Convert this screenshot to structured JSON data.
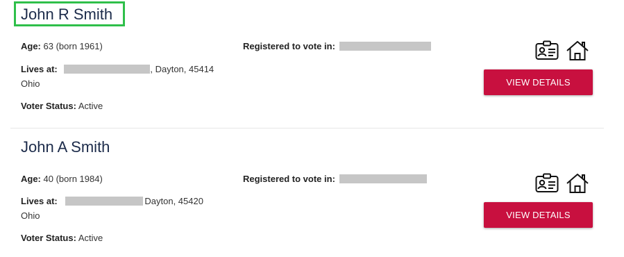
{
  "results": [
    {
      "name": "John R Smith",
      "age_label": "Age:",
      "age_value": "63 (born 1961)",
      "lives_label": "Lives at:",
      "city_zip": ", Dayton, 45414",
      "state": "Ohio",
      "registered_label": "Registered to vote in:",
      "voter_status_label": "Voter Status:",
      "voter_status_value": "Active",
      "button_label": "VIEW DETAILS",
      "highlighted": true
    },
    {
      "name": "John A Smith",
      "age_label": "Age:",
      "age_value": "40 (born 1984)",
      "lives_label": "Lives at:",
      "city_zip": "Dayton, 45420",
      "state": "Ohio",
      "registered_label": "Registered to vote in:",
      "voter_status_label": "Voter Status:",
      "voter_status_value": "Active",
      "button_label": "VIEW DETAILS",
      "highlighted": false
    }
  ],
  "icons": {
    "id_card": "id-card-icon",
    "home": "home-icon"
  },
  "colors": {
    "name_text": "#1c2b4a",
    "button_bg": "#c8103f",
    "highlight_border": "#2fbf4a",
    "redaction": "#c6c6c6"
  }
}
